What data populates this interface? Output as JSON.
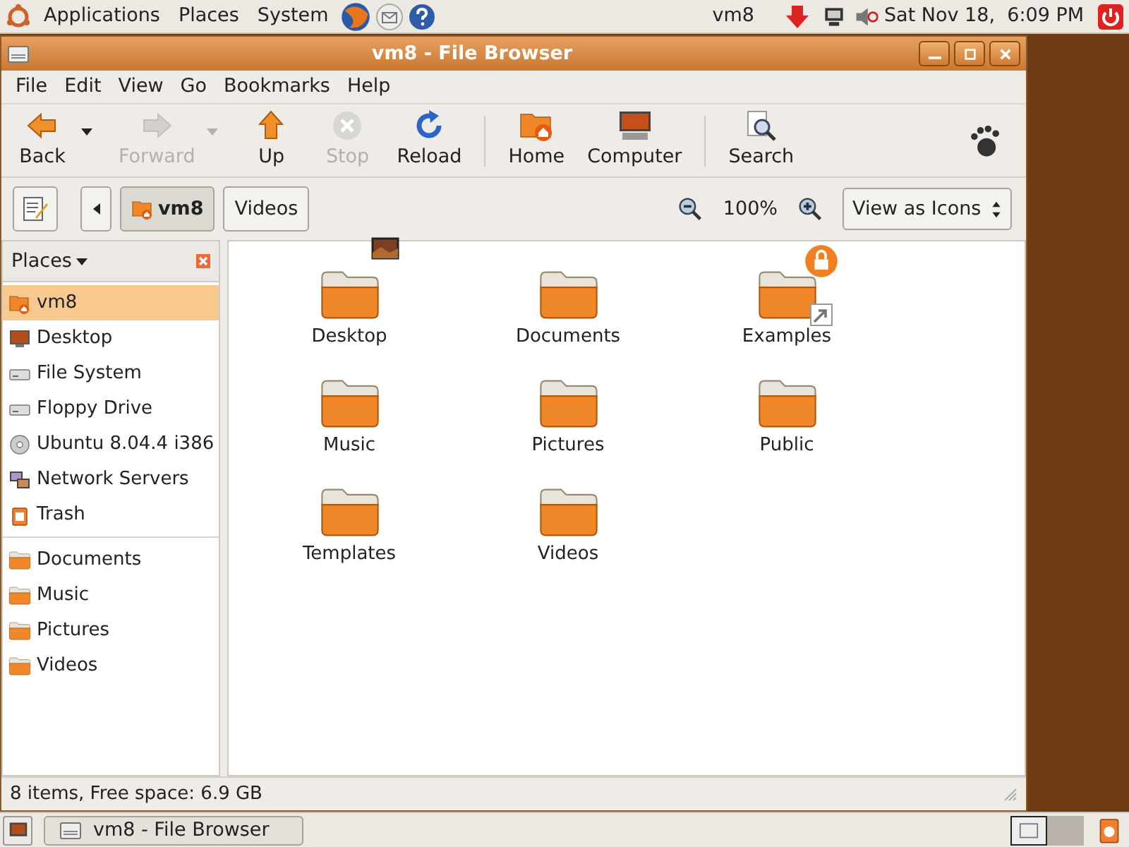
{
  "top_panel": {
    "menus": [
      "Applications",
      "Places",
      "System"
    ],
    "user": "vm8",
    "clock": "Sat Nov 18,  6:09 PM"
  },
  "window": {
    "title": "vm8 - File Browser"
  },
  "menu_bar": [
    "File",
    "Edit",
    "View",
    "Go",
    "Bookmarks",
    "Help"
  ],
  "toolbar": {
    "groups": [
      [
        {
          "label": "Back",
          "kind": "back",
          "disabled": false,
          "dropdown": true
        },
        {
          "label": "Forward",
          "kind": "forward",
          "disabled": true,
          "dropdown": true
        },
        {
          "label": "Up",
          "kind": "up",
          "disabled": false,
          "dropdown": false
        },
        {
          "label": "Stop",
          "kind": "stop",
          "disabled": true,
          "dropdown": false
        },
        {
          "label": "Reload",
          "kind": "reload",
          "disabled": false,
          "dropdown": false
        }
      ],
      [
        {
          "label": "Home",
          "kind": "home",
          "disabled": false,
          "dropdown": false
        },
        {
          "label": "Computer",
          "kind": "computer",
          "disabled": false,
          "dropdown": false
        }
      ],
      [
        {
          "label": "Search",
          "kind": "search",
          "disabled": false,
          "dropdown": false
        }
      ]
    ]
  },
  "location_bar": {
    "path": [
      {
        "label": "vm8",
        "selected": true,
        "kind": "home"
      },
      {
        "label": "Videos",
        "selected": false,
        "kind": "plain"
      }
    ],
    "zoom": "100%",
    "view_mode": "View as Icons"
  },
  "sidebar": {
    "title": "Places",
    "sections": [
      [
        {
          "label": "vm8",
          "kind": "home",
          "selected": true
        },
        {
          "label": "Desktop",
          "kind": "desktop",
          "selected": false
        },
        {
          "label": "File System",
          "kind": "drive",
          "selected": false
        },
        {
          "label": "Floppy Drive",
          "kind": "drive",
          "selected": false
        },
        {
          "label": "Ubuntu 8.04.4 i386",
          "kind": "cd",
          "selected": false
        },
        {
          "label": "Network Servers",
          "kind": "network",
          "selected": false
        },
        {
          "label": "Trash",
          "kind": "trash",
          "selected": false
        }
      ],
      [
        {
          "label": "Documents",
          "kind": "folder",
          "selected": false
        },
        {
          "label": "Music",
          "kind": "folder",
          "selected": false
        },
        {
          "label": "Pictures",
          "kind": "folder",
          "selected": false
        },
        {
          "label": "Videos",
          "kind": "folder",
          "selected": false
        }
      ]
    ]
  },
  "files": [
    {
      "name": "Desktop",
      "kind": "image-badge"
    },
    {
      "name": "Documents",
      "kind": "plain"
    },
    {
      "name": "Examples",
      "kind": "locked-link"
    },
    {
      "name": "Music",
      "kind": "plain"
    },
    {
      "name": "Pictures",
      "kind": "plain"
    },
    {
      "name": "Public",
      "kind": "plain"
    },
    {
      "name": "Templates",
      "kind": "plain"
    },
    {
      "name": "Videos",
      "kind": "plain"
    }
  ],
  "status_bar": "8 items, Free space: 6.9 GB",
  "taskbar": {
    "tasks": [
      {
        "label": "vm8 - File Browser",
        "selected": false
      }
    ]
  }
}
